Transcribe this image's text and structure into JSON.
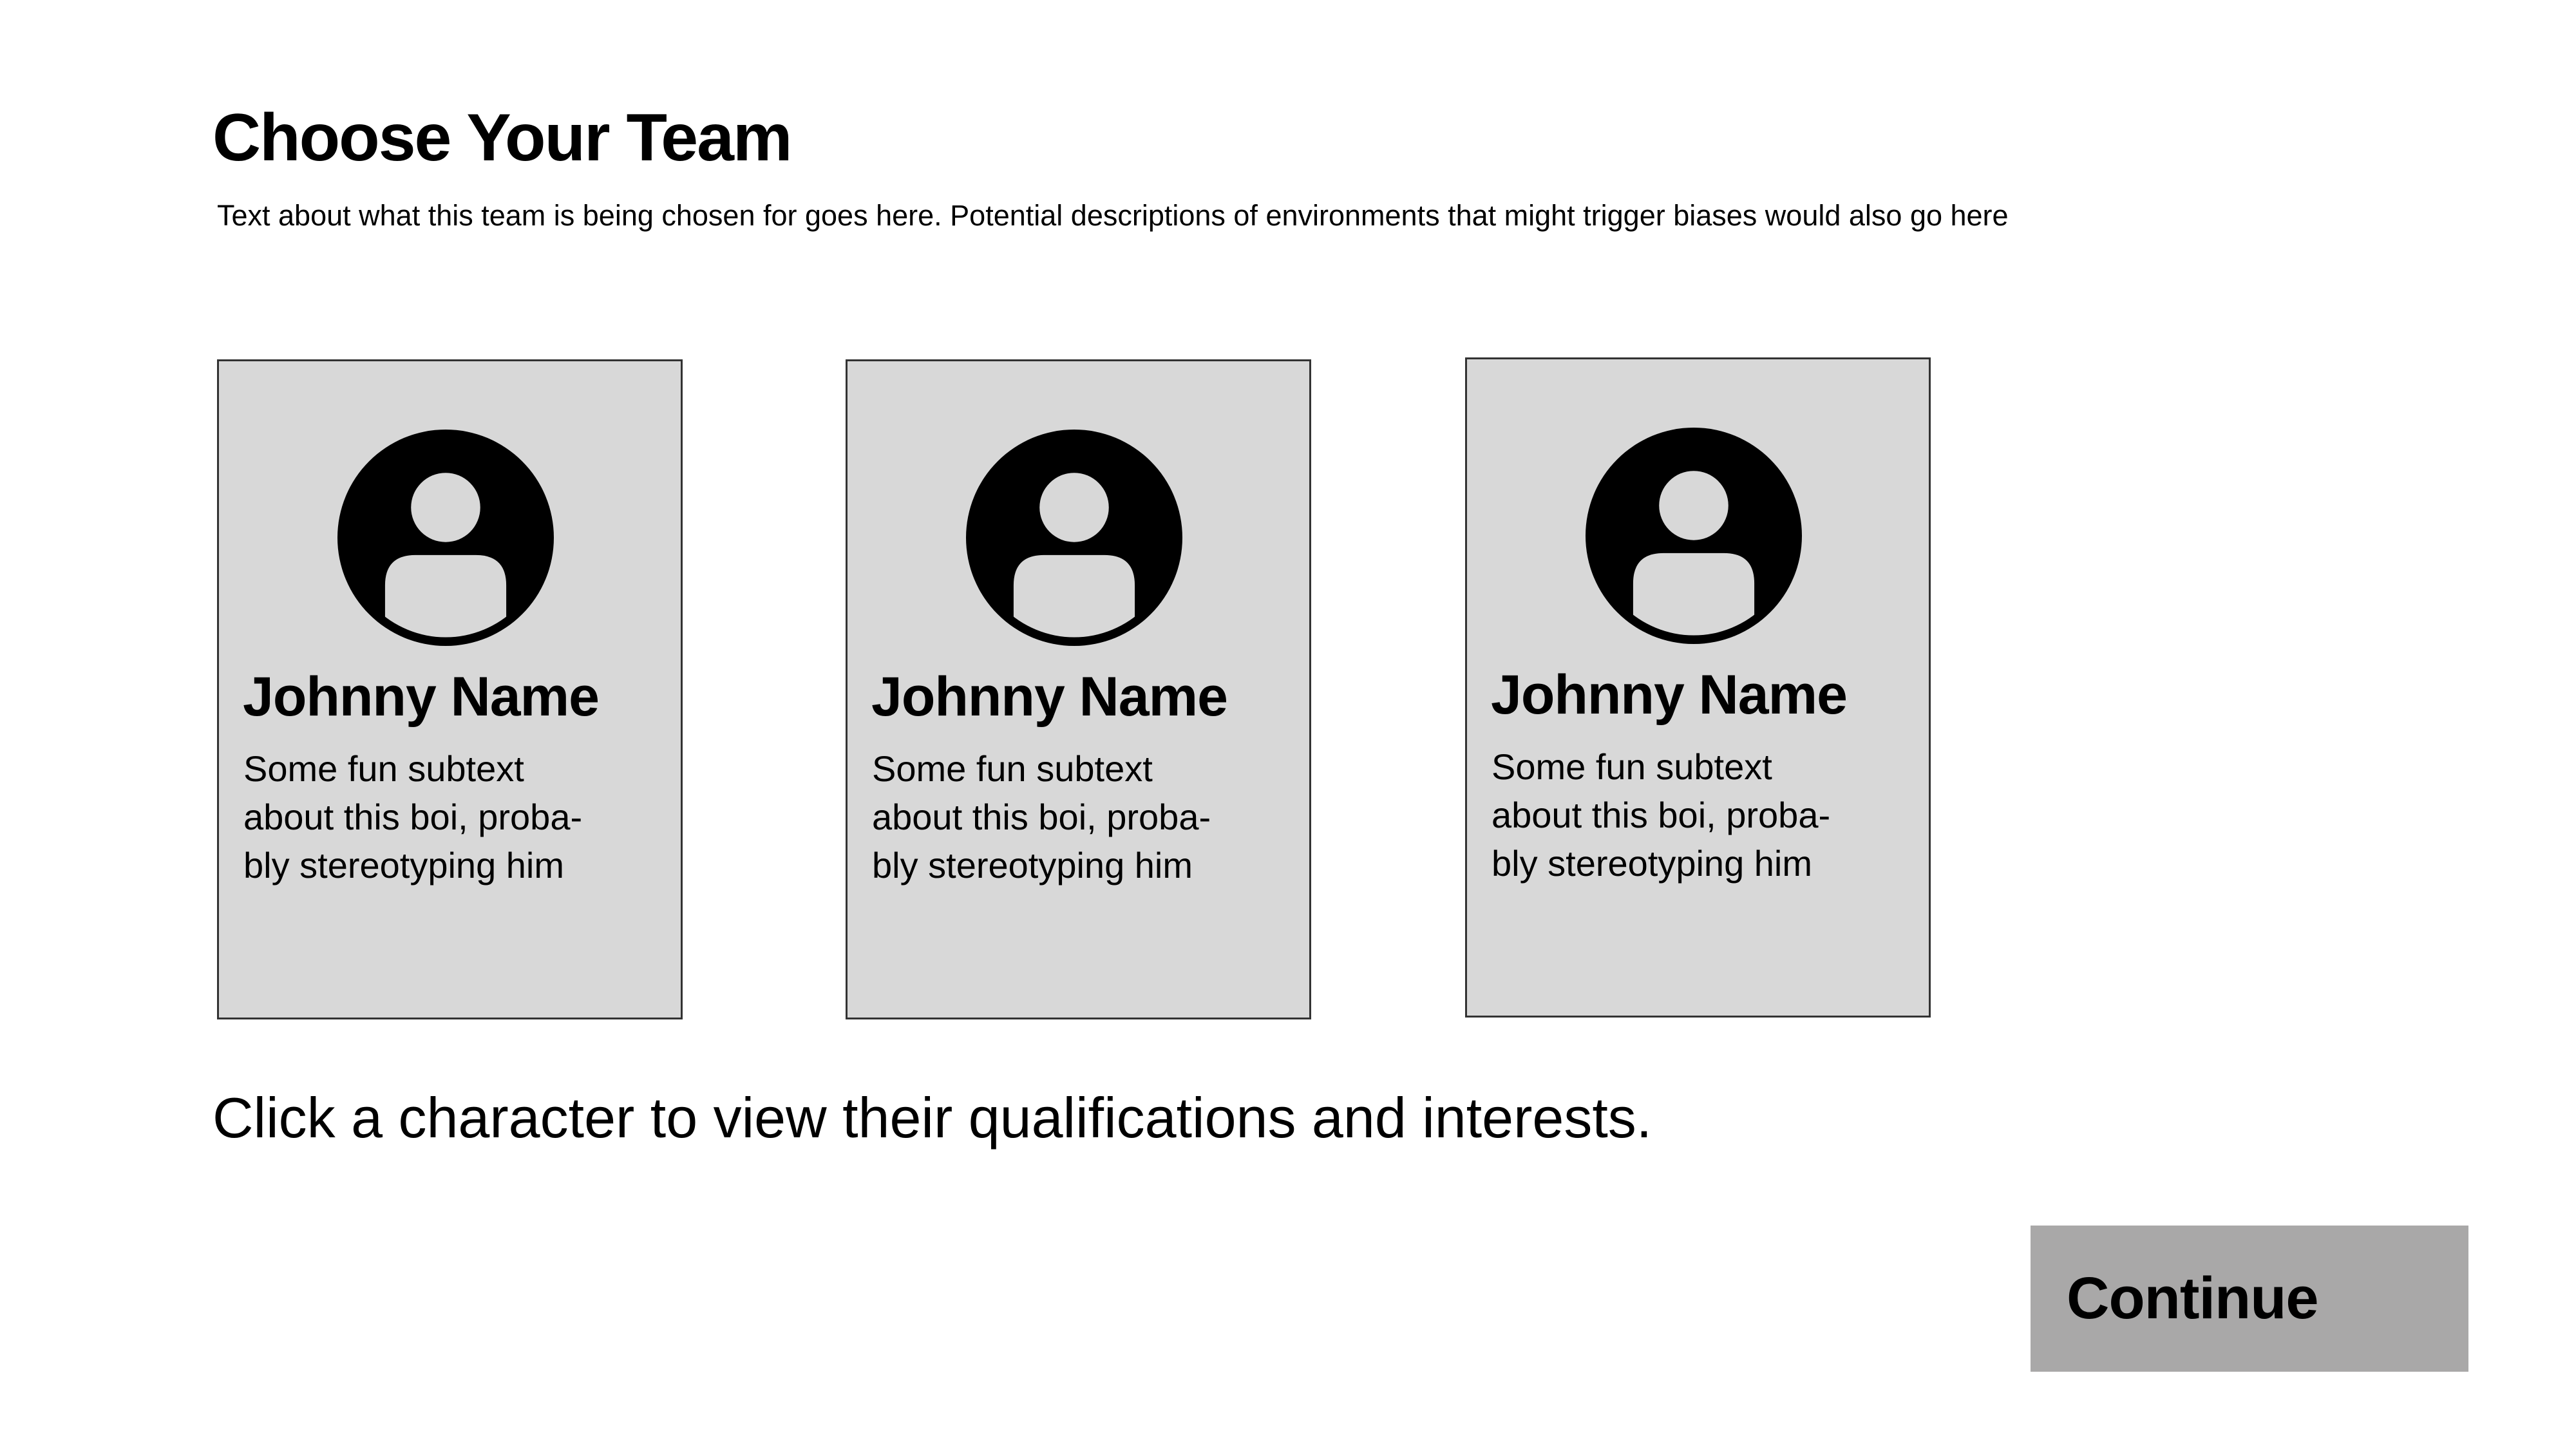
{
  "page": {
    "title": "Choose Your Team",
    "description": "Text about what this team is being chosen for goes here. Potential descriptions of environments that might trigger biases would also go here",
    "instruction": "Click a character to view their qualifications and interests."
  },
  "cards": [
    {
      "icon": "user-avatar-icon",
      "name": "Johnny Name",
      "subtext_lines": [
        "Some fun subtext",
        "about this boi, proba-",
        "bly stereotyping him"
      ]
    },
    {
      "icon": "user-avatar-icon",
      "name": "Johnny Name",
      "subtext_lines": [
        "Some fun subtext",
        "about this boi, proba-",
        "bly stereotyping him"
      ]
    },
    {
      "icon": "user-avatar-icon",
      "name": "Johnny Name",
      "subtext_lines": [
        "Some fun subtext",
        "about this boi, proba-",
        "bly stereotyping him"
      ]
    }
  ],
  "continue_button": {
    "label": "Continue"
  },
  "colors": {
    "card_background": "#d8d8d8",
    "card_border": "#333333",
    "button_background": "#a9a8a8",
    "text": "#000000"
  }
}
